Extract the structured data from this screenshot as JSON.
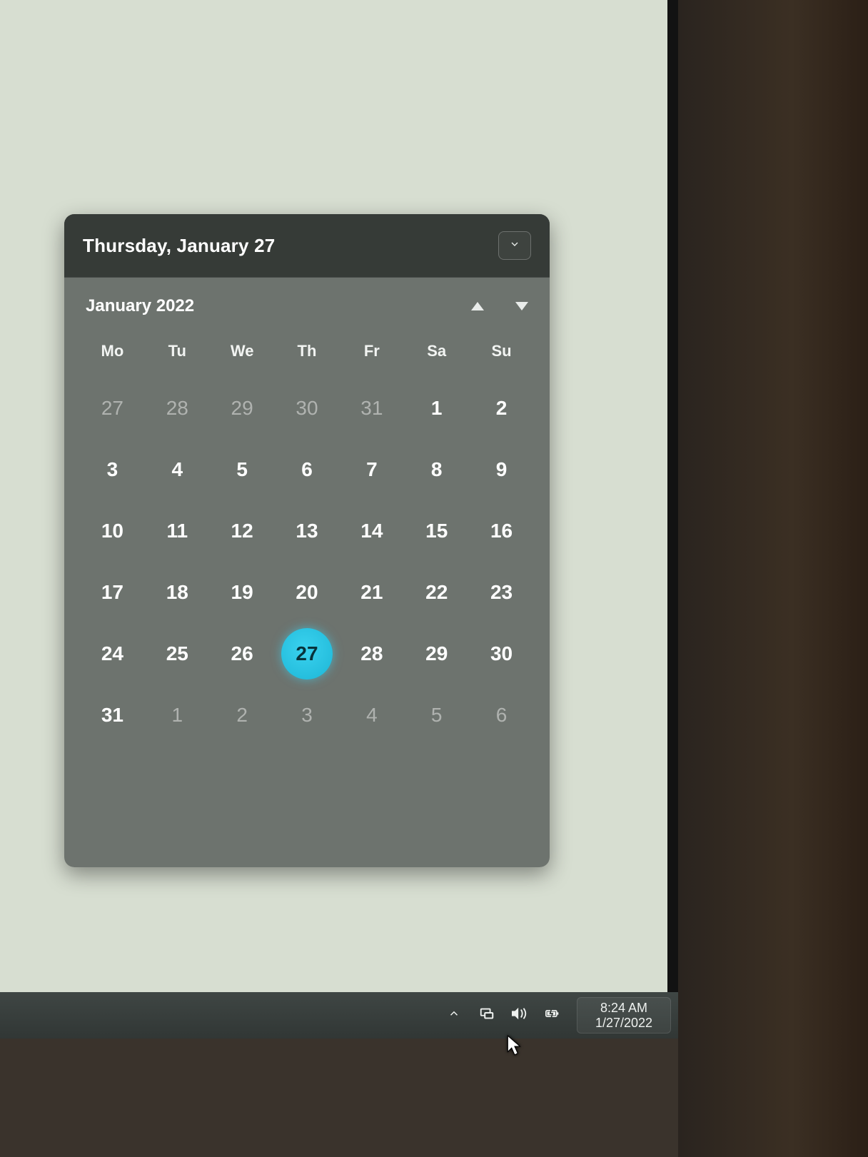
{
  "calendar": {
    "full_date_label": "Thursday, January 27",
    "month_title": "January 2022",
    "days_of_week": [
      "Mo",
      "Tu",
      "We",
      "Th",
      "Fr",
      "Sa",
      "Su"
    ],
    "cells": [
      {
        "n": "27",
        "outside": true
      },
      {
        "n": "28",
        "outside": true
      },
      {
        "n": "29",
        "outside": true
      },
      {
        "n": "30",
        "outside": true
      },
      {
        "n": "31",
        "outside": true
      },
      {
        "n": "1"
      },
      {
        "n": "2"
      },
      {
        "n": "3"
      },
      {
        "n": "4"
      },
      {
        "n": "5"
      },
      {
        "n": "6"
      },
      {
        "n": "7"
      },
      {
        "n": "8"
      },
      {
        "n": "9"
      },
      {
        "n": "10"
      },
      {
        "n": "11"
      },
      {
        "n": "12"
      },
      {
        "n": "13"
      },
      {
        "n": "14"
      },
      {
        "n": "15"
      },
      {
        "n": "16"
      },
      {
        "n": "17"
      },
      {
        "n": "18"
      },
      {
        "n": "19"
      },
      {
        "n": "20"
      },
      {
        "n": "21"
      },
      {
        "n": "22"
      },
      {
        "n": "23"
      },
      {
        "n": "24"
      },
      {
        "n": "25"
      },
      {
        "n": "26"
      },
      {
        "n": "27",
        "today": true
      },
      {
        "n": "28"
      },
      {
        "n": "29"
      },
      {
        "n": "30"
      },
      {
        "n": "31"
      },
      {
        "n": "1",
        "outside": true
      },
      {
        "n": "2",
        "outside": true
      },
      {
        "n": "3",
        "outside": true
      },
      {
        "n": "4",
        "outside": true
      },
      {
        "n": "5",
        "outside": true
      },
      {
        "n": "6",
        "outside": true
      }
    ]
  },
  "taskbar": {
    "time": "8:24 AM",
    "date": "1/27/2022"
  },
  "colors": {
    "accent": "#1db6d6",
    "panel": "#535855"
  }
}
